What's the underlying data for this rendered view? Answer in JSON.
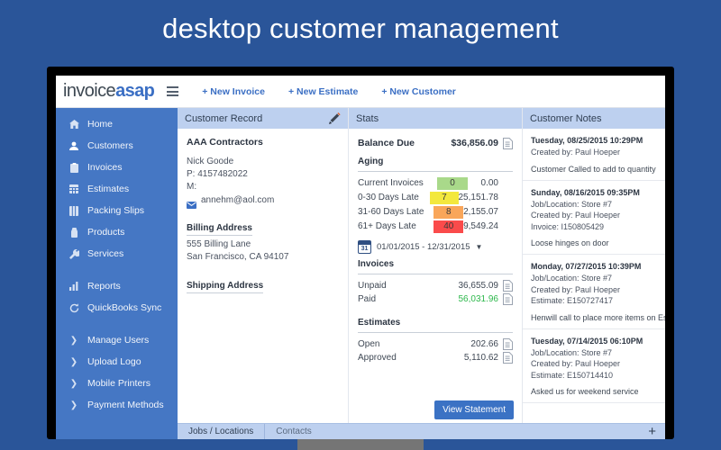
{
  "headline": "desktop customer management",
  "app": {
    "logo_part1": "invoice",
    "logo_part2": "asap",
    "menu_icon": "hamburger-icon",
    "topnav": [
      {
        "label": "+ New Invoice"
      },
      {
        "label": "+ New Estimate"
      },
      {
        "label": "+ New Customer"
      }
    ]
  },
  "sidebar": {
    "items": [
      {
        "label": "Home",
        "icon": "home-icon"
      },
      {
        "label": "Customers",
        "icon": "user-icon"
      },
      {
        "label": "Invoices",
        "icon": "invoice-icon"
      },
      {
        "label": "Estimates",
        "icon": "grid-icon"
      },
      {
        "label": "Packing Slips",
        "icon": "box-icon"
      },
      {
        "label": "Products",
        "icon": "product-icon"
      },
      {
        "label": "Services",
        "icon": "wrench-icon"
      }
    ],
    "items2": [
      {
        "label": "Reports",
        "icon": "bar-chart-icon"
      },
      {
        "label": "QuickBooks Sync",
        "icon": "sync-icon"
      }
    ],
    "items3": [
      {
        "label": "Manage Users",
        "icon": "chevron-right-icon"
      },
      {
        "label": "Upload Logo",
        "icon": "chevron-right-icon"
      },
      {
        "label": "Mobile Printers",
        "icon": "chevron-right-icon"
      },
      {
        "label": "Payment Methods",
        "icon": "chevron-right-icon"
      }
    ]
  },
  "record": {
    "panel_title": "Customer Record",
    "edit_icon": "pencil-icon",
    "company": "AAA Contractors",
    "contact": "Nick Goode",
    "phone": "P: 4157482022",
    "mobile": "M:",
    "email": "annehm@aol.com",
    "email_icon": "envelope-icon",
    "billing_title": "Billing Address",
    "billing_line1": "555 Billing Lane",
    "billing_line2": "San Francisco, CA 94107",
    "shipping_title": "Shipping Address"
  },
  "stats": {
    "panel_title": "Stats",
    "balance_label": "Balance Due",
    "balance_value": "$36,856.09",
    "doc_icon": "document-icon",
    "aging_title": "Aging",
    "aging": [
      {
        "label": "Current Invoices",
        "count": "0",
        "amount": "0.00",
        "color": "#a9d98a"
      },
      {
        "label": "0-30 Days Late",
        "count": "7",
        "amount": "25,151.78",
        "color": "#f3e83e"
      },
      {
        "label": "31-60 Days Late",
        "count": "8",
        "amount": "2,155.07",
        "color": "#f9a65a"
      },
      {
        "label": "61+ Days Late",
        "count": "40",
        "amount": "9,549.24",
        "color": "#fa4b4b"
      }
    ],
    "calendar_icon": "calendar-icon",
    "calendar_day": "31",
    "date_range": "01/01/2015 - 12/31/2015",
    "caret_icon": "caret-down-icon",
    "invoices_title": "Invoices",
    "invoices": [
      {
        "label": "Unpaid",
        "value": "36,655.09",
        "color": "#3f4854"
      },
      {
        "label": "Paid",
        "value": "56,031.96",
        "color": "#2db84c"
      }
    ],
    "estimates_title": "Estimates",
    "estimates": [
      {
        "label": "Open",
        "value": "202.66"
      },
      {
        "label": "Approved",
        "value": "5,110.62"
      }
    ],
    "view_statement": "View Statement"
  },
  "notes": {
    "panel_title": "Customer Notes",
    "items": [
      {
        "date": "Tuesday, 08/25/2015 10:29PM",
        "meta": [
          "Created by: Paul Hoeper"
        ],
        "body": "Customer Called to add to quantity"
      },
      {
        "date": "Sunday, 08/16/2015 09:35PM",
        "meta": [
          "Job/Location: Store #7",
          "Created by: Paul Hoeper",
          "Invoice: I150805429"
        ],
        "body": "Loose hinges on door"
      },
      {
        "date": "Monday, 07/27/2015 10:39PM",
        "meta": [
          "Job/Location: Store #7",
          "Created by: Paul Hoeper",
          "Estimate: E150727417"
        ],
        "body": "Henwill call to place more items on Estima"
      },
      {
        "date": "Tuesday, 07/14/2015 06:10PM",
        "meta": [
          "Job/Location: Store #7",
          "Created by: Paul Hoeper",
          "Estimate: E150714410"
        ],
        "body": "Asked us for weekend service"
      }
    ]
  },
  "bottom_tabs": {
    "tabs": [
      {
        "label": "Jobs / Locations"
      },
      {
        "label": "Contacts"
      }
    ],
    "add_label": "+"
  }
}
